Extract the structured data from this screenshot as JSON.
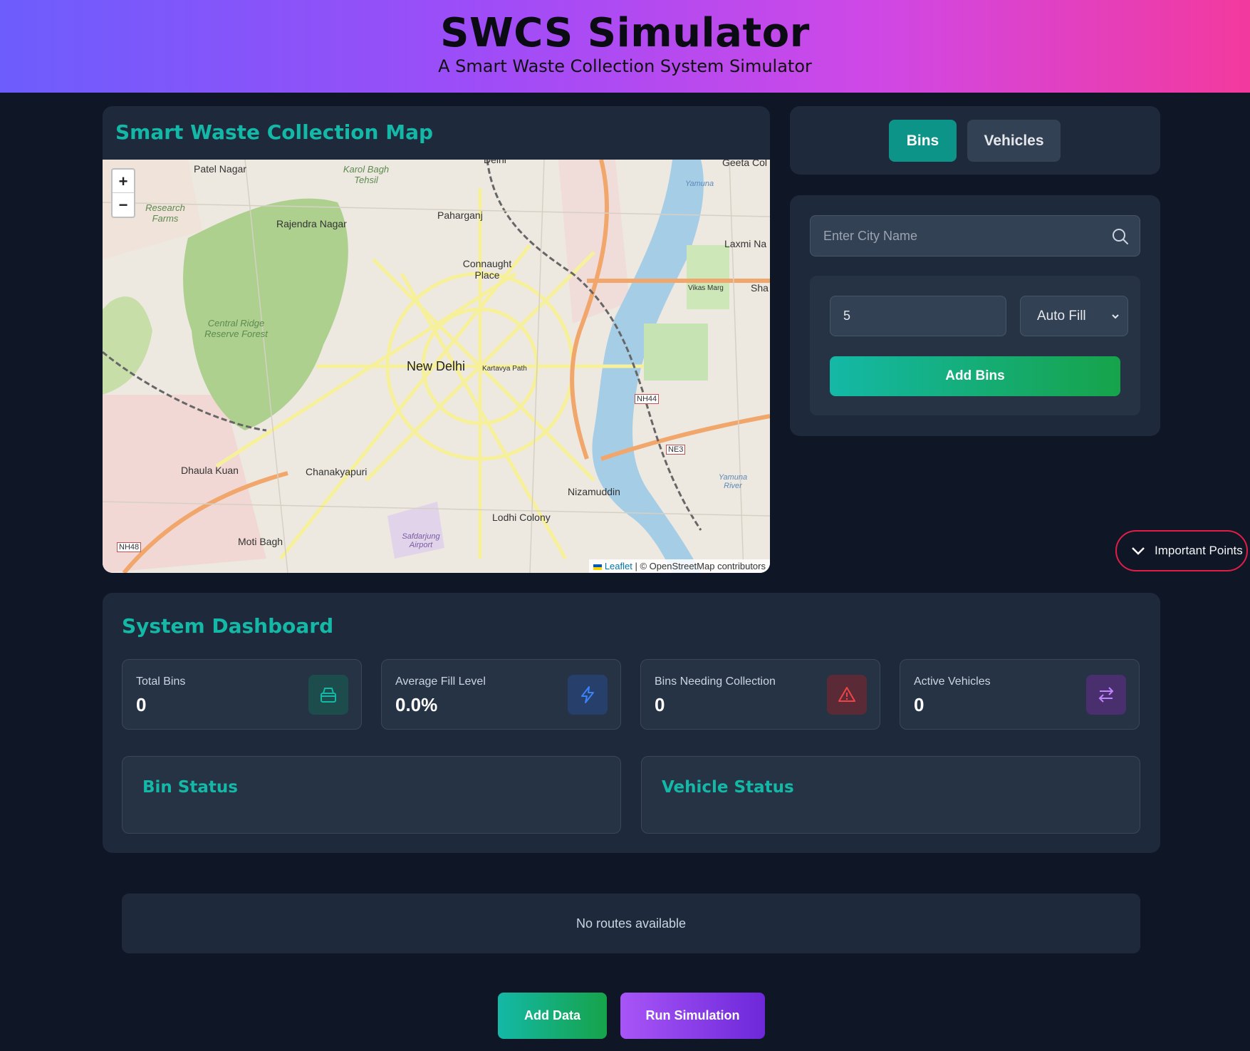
{
  "header": {
    "title": "SWCS Simulator",
    "subtitle": "A Smart Waste Collection System Simulator"
  },
  "map": {
    "title": "Smart Waste Collection Map",
    "zoom_in": "+",
    "zoom_out": "−",
    "attribution_leaflet": "Leaflet",
    "attribution_rest": "| © OpenStreetMap contributors",
    "labels": {
      "patel_nagar": "Patel Nagar",
      "karol_bagh": "Karol Bagh Tehsil",
      "delhi": "Delhi",
      "geeta_colony": "Geeta Col",
      "research_farms": "Research Farms",
      "rajendra_nagar": "Rajendra Nagar",
      "paharganj": "Paharganj",
      "laxmi_nagar": "Laxmi Na",
      "connaught_place": "Connaught Place",
      "central_ridge": "Central Ridge Reserve Forest",
      "new_delhi": "New Delhi",
      "kartavya_path": "Kartavya Path",
      "nh44": "NH44",
      "ne3": "NE3",
      "dhaula_kuan": "Dhaula Kuan",
      "chanakyapuri": "Chanakyapuri",
      "nizamuddin": "Nizamuddin",
      "lodhi_colony": "Lodhi Colony",
      "moti_bagh": "Moti Bagh",
      "nh48": "NH48",
      "safdarjung_airport": "Safdarjung Airport",
      "yamuna": "Yamuna",
      "yamuna_river": "Yamuna River",
      "vikas_marg": "Vikas Marg",
      "sha": "Sha"
    }
  },
  "tabs": {
    "bins": "Bins",
    "vehicles": "Vehicles",
    "active": "bins"
  },
  "controls": {
    "city_placeholder": "Enter City Name",
    "bin_count": "5",
    "mode_selected": "Auto Fill",
    "add_bins_label": "Add Bins"
  },
  "important_points": "Important Points",
  "dashboard": {
    "title": "System Dashboard",
    "stats": [
      {
        "label": "Total Bins",
        "value": "0",
        "icon": "bin-icon",
        "color": "#14b8a6"
      },
      {
        "label": "Average Fill Level",
        "value": "0.0%",
        "icon": "lightning-icon",
        "color": "#3b82f6"
      },
      {
        "label": "Bins Needing Collection",
        "value": "0",
        "icon": "warning-icon",
        "color": "#ef4444"
      },
      {
        "label": "Active Vehicles",
        "value": "0",
        "icon": "arrows-exchange-icon",
        "color": "#a855f7"
      }
    ],
    "bin_status_title": "Bin Status",
    "vehicle_status_title": "Vehicle Status"
  },
  "routes": {
    "empty_text": "No routes available"
  },
  "actions": {
    "add_data": "Add Data",
    "run_simulation": "Run Simulation"
  },
  "colors": {
    "accent": "#14b8a6",
    "background": "#0f1727",
    "panel": "#1e293b",
    "danger": "#e11d48",
    "purple": "#a855f7"
  }
}
